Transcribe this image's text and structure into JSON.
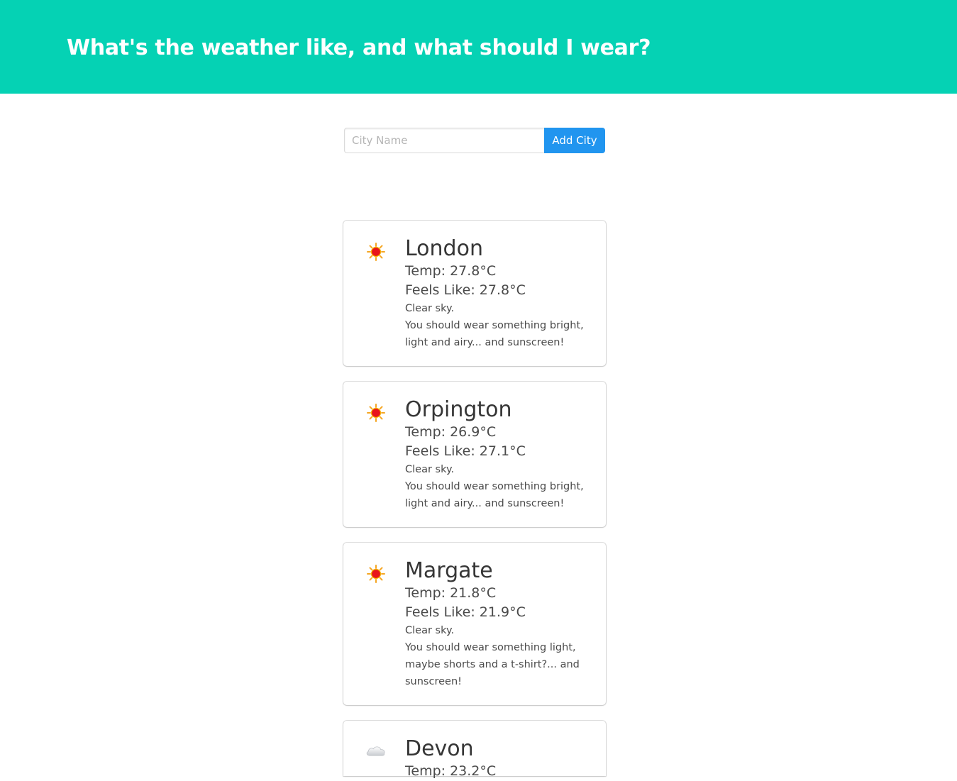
{
  "header": {
    "title": "What's the weather like, and what should I wear?",
    "background_color": "#05d2b4"
  },
  "form": {
    "placeholder": "City Name",
    "value": "",
    "button_label": "Add City",
    "button_color": "#2195ef"
  },
  "cities": [
    {
      "name": "London",
      "icon": "sun-icon",
      "temp": "Temp: 27.8°C",
      "feels_like": "Feels Like: 27.8°C",
      "description": "Clear sky.",
      "advice": "You should wear something bright, light and airy... and sunscreen!"
    },
    {
      "name": "Orpington",
      "icon": "sun-icon",
      "temp": "Temp: 26.9°C",
      "feels_like": "Feels Like: 27.1°C",
      "description": "Clear sky.",
      "advice": "You should wear something bright, light and airy... and sunscreen!"
    },
    {
      "name": "Margate",
      "icon": "sun-icon",
      "temp": "Temp: 21.8°C",
      "feels_like": "Feels Like: 21.9°C",
      "description": "Clear sky.",
      "advice": "You should wear something light, maybe shorts and a t-shirt?... and sunscreen!"
    },
    {
      "name": "Devon",
      "icon": "cloud-icon",
      "temp": "Temp: 23.2°C"
    }
  ]
}
